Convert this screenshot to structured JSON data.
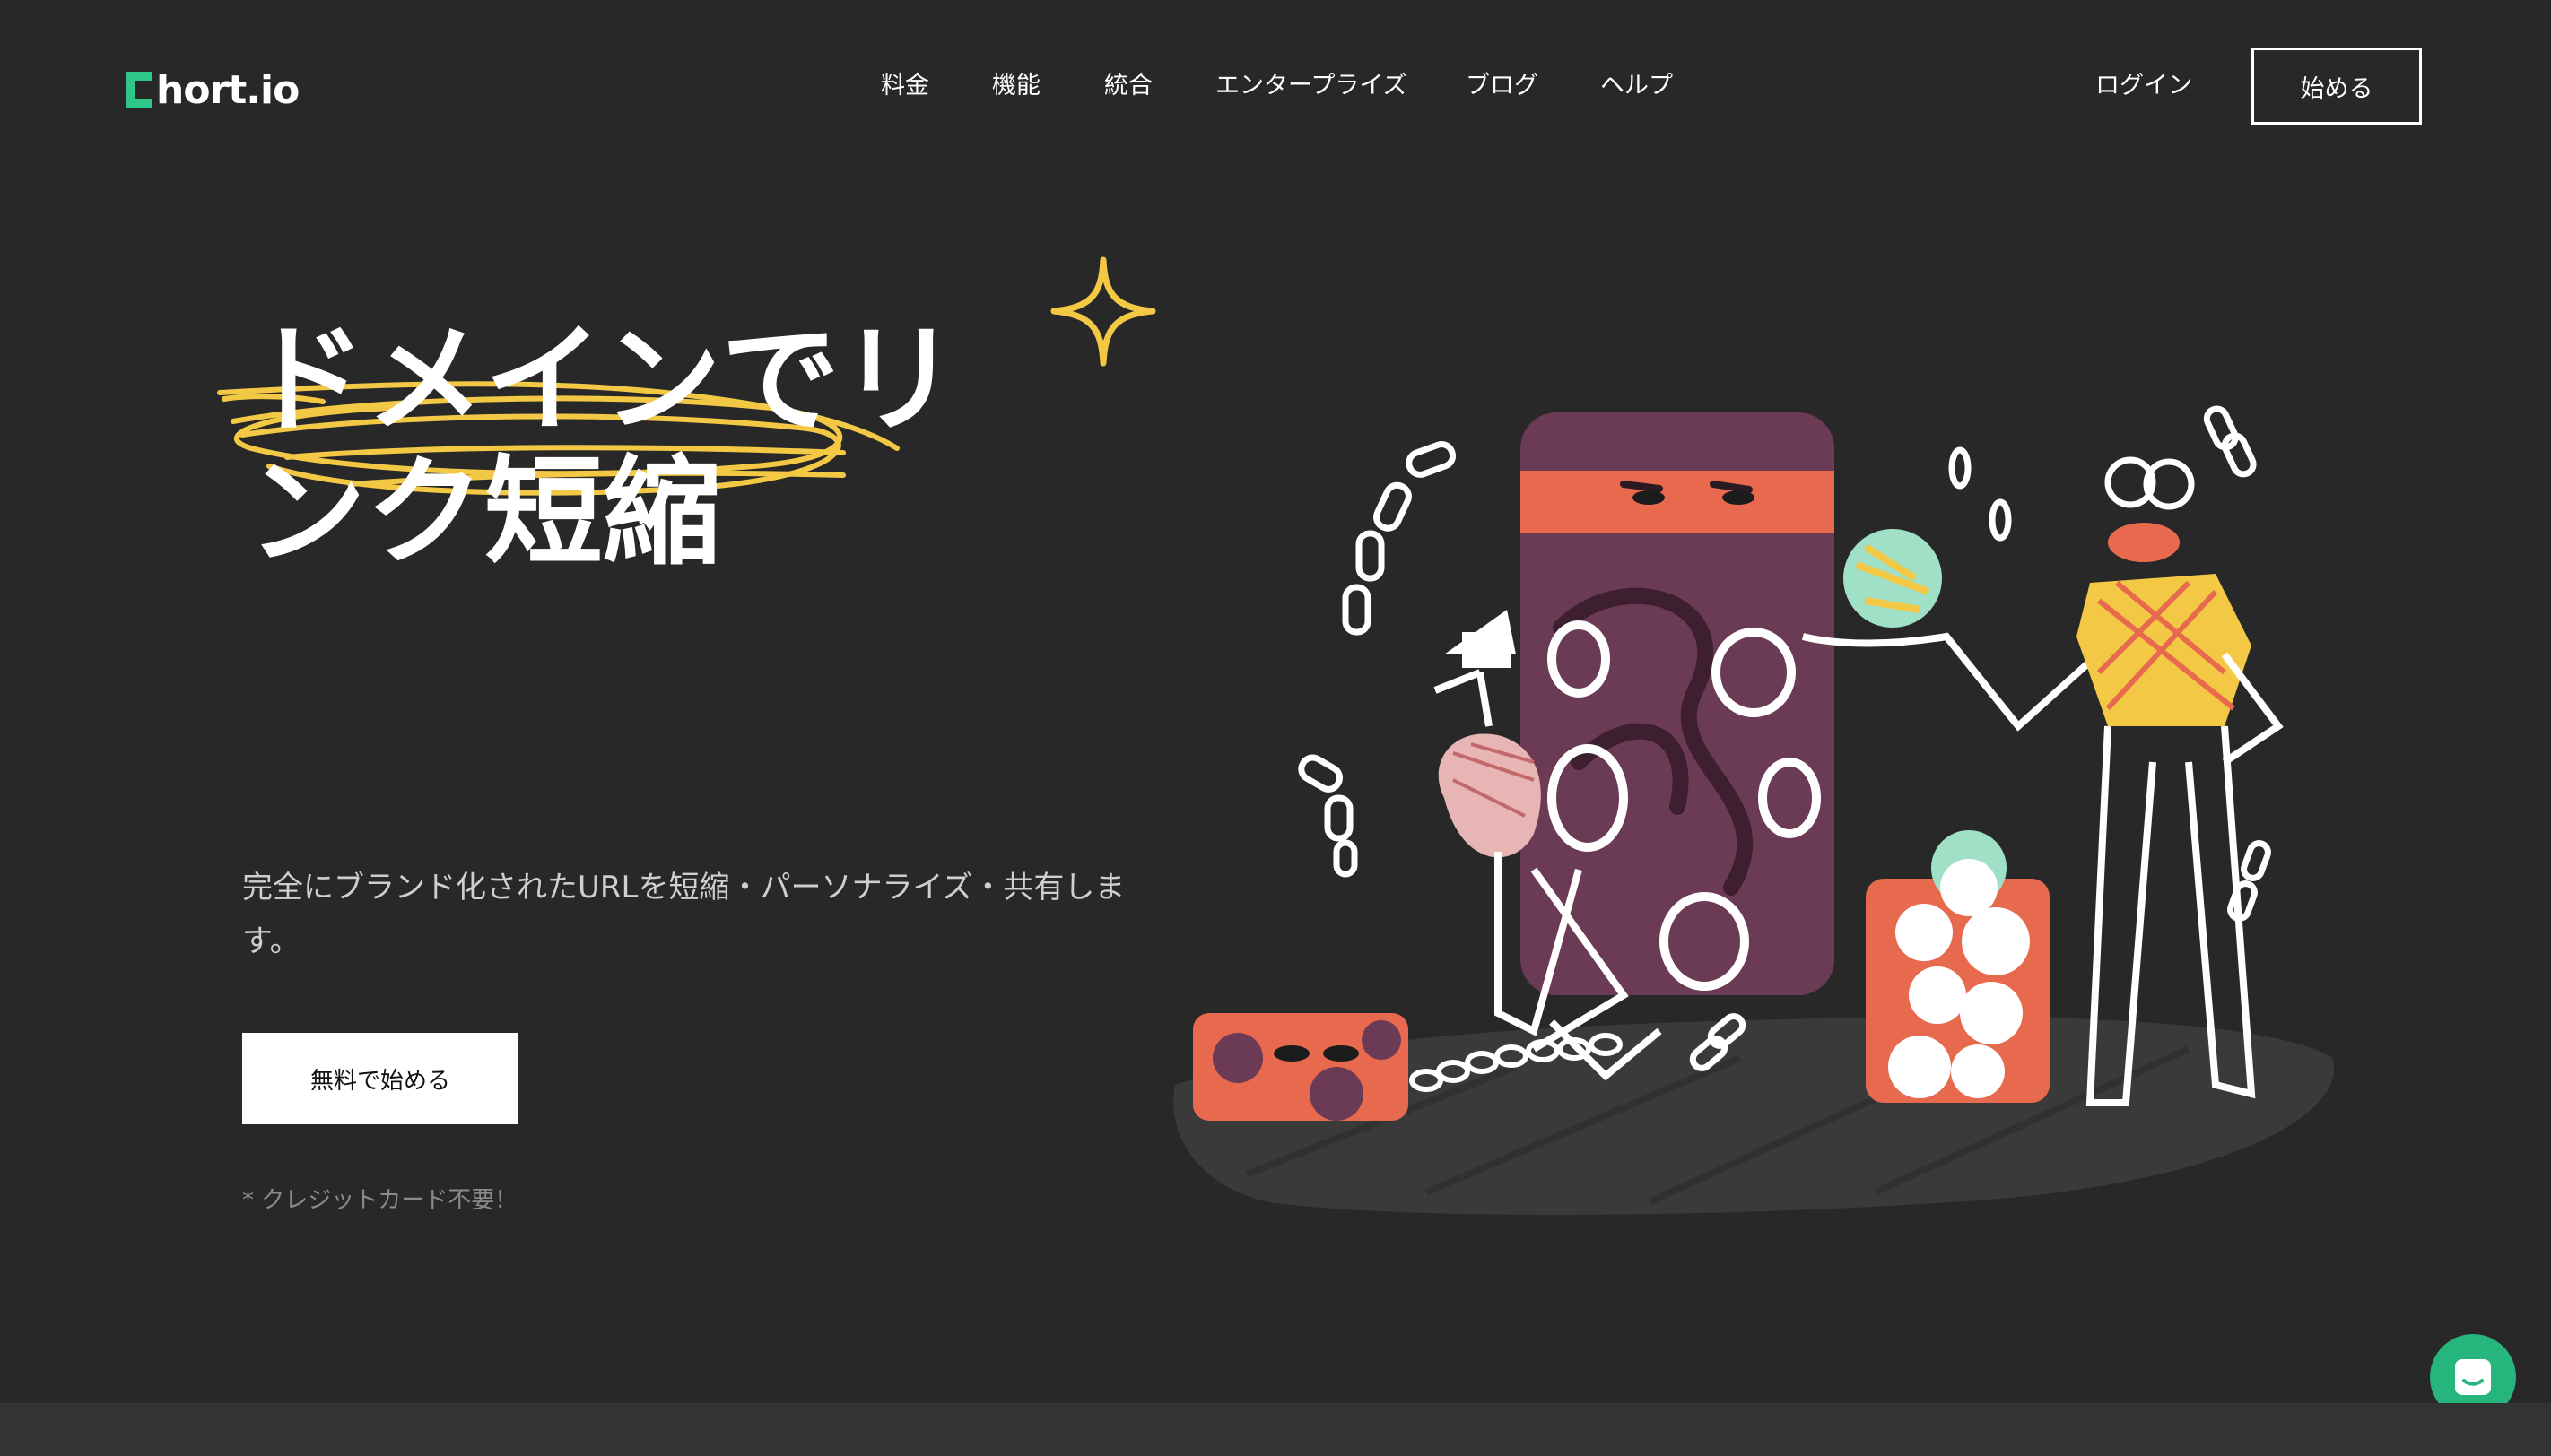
{
  "brand": {
    "logo_text": "hort.io",
    "logo_letter": "S",
    "accent": "#2fc68a"
  },
  "nav": {
    "items": [
      "料金",
      "機能",
      "統合",
      "エンタープライズ",
      "ブログ",
      "ヘルプ"
    ],
    "login": "ログイン",
    "start": "始める"
  },
  "hero": {
    "title_line1": "ドメインでリ",
    "title_line2": "ンク短縮",
    "description": "完全にブランド化されたURLを短縮・パーソナライズ・共有します。",
    "cta": "無料で始める",
    "note": "* クレジットカード不要！"
  },
  "chat": {
    "icon": "chat-icon",
    "color": "#25b57d"
  }
}
